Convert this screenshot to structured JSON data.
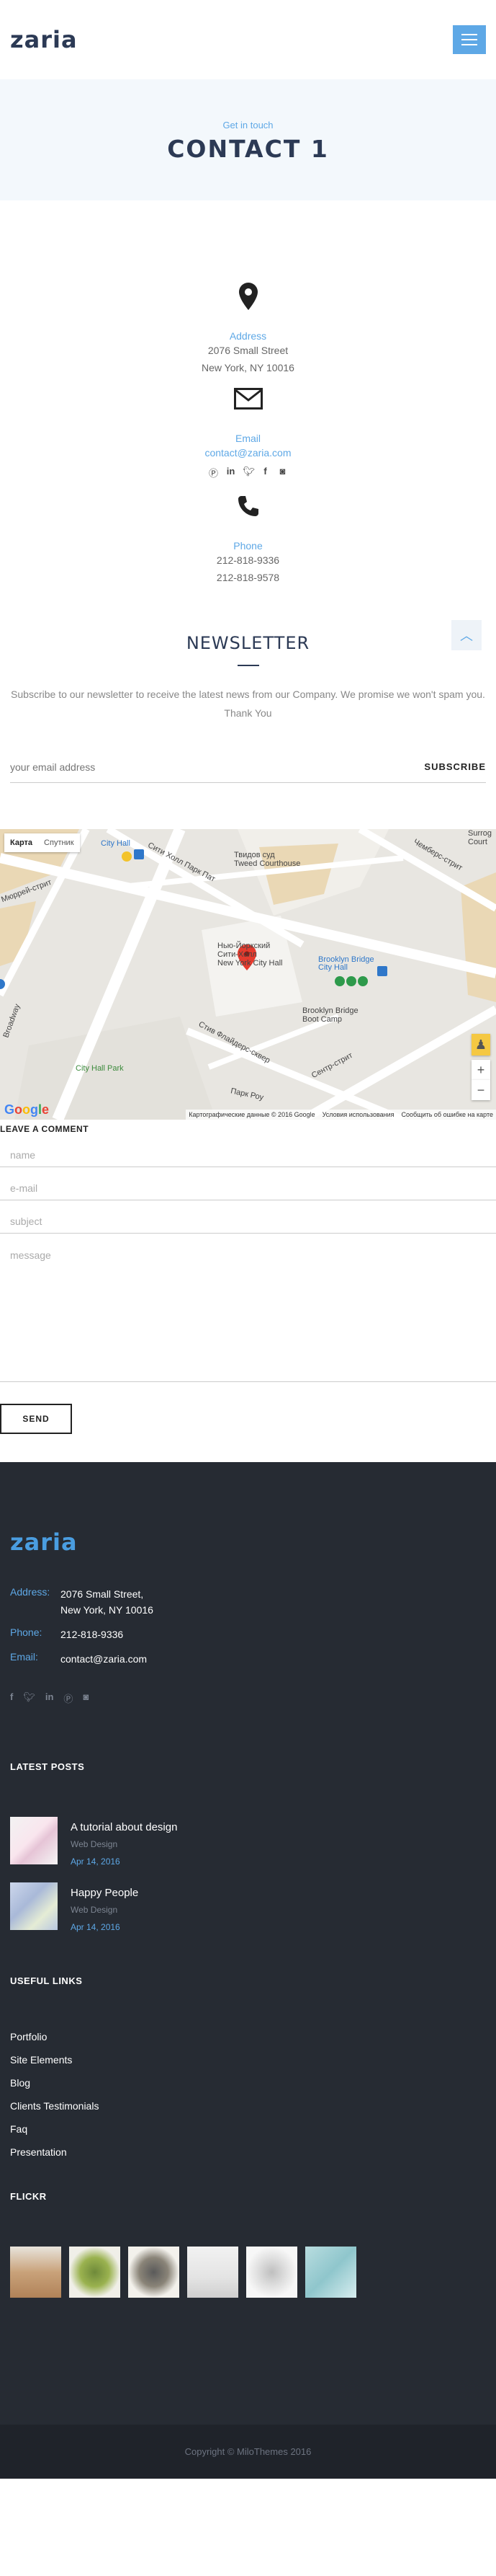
{
  "header": {
    "logo": "zaria",
    "menu_icon": "hamburger-icon"
  },
  "hero": {
    "subtitle": "Get in touch",
    "title": "CONTACT 1"
  },
  "contact": {
    "address": {
      "icon": "map-pin-icon",
      "label": "Address",
      "lines": [
        "2076 Small Street",
        "New York, NY 10016"
      ]
    },
    "email": {
      "icon": "envelope-icon",
      "label": "Email",
      "value": "contact@zaria.com"
    },
    "socials": [
      "pinterest-icon",
      "linkedin-icon",
      "twitter-icon",
      "facebook-icon",
      "instagram-icon"
    ],
    "phone": {
      "icon": "phone-icon",
      "label": "Phone",
      "lines": [
        "212-818-9336",
        "212-818-9578"
      ]
    }
  },
  "newsletter": {
    "title": "NEWSLETTER",
    "text": "Subscribe to our newsletter to receive the latest news from our Company. We promise we won't spam you. Thank You",
    "placeholder": "your email address",
    "button": "SUBSCRIBE"
  },
  "map": {
    "type_map": "Карта",
    "type_sat": "Спутник",
    "attribution": [
      "Картографические данные © 2016 Google",
      "Условия использования",
      "Сообщить об ошибке на карте"
    ],
    "google": "Google",
    "labels": {
      "courthouse": "Твидов суд\nTweed Courthouse",
      "city_hall_station": "City Hall",
      "city_hall": "Нью-Йоркский\nСити-Холл\nNew York City Hall",
      "brooklyn_bridge_station": "Brooklyn Bridge\nCity Hall",
      "boot_camp": "Brooklyn Bridge\nBoot Camp",
      "park": "City Hall Park",
      "park_row": "Парк Роу",
      "chambers": "Чемберс-стрит",
      "murray": "Мюррей-стрит",
      "broadway": "Broadway",
      "centre": "Сентр-стрит",
      "park_place": "Сити Холл Парк Пат",
      "frankfort": "Стив Флайдерс-сквер",
      "surrogate": "Surrog\nCourt",
      "subway_lines": "4 5 6"
    }
  },
  "comment": {
    "title": "LEAVE A COMMENT",
    "name": "name",
    "email": "e-mail",
    "subject": "subject",
    "message": "message",
    "send": "SEND"
  },
  "footer": {
    "logo": "zaria",
    "address_label": "Address:",
    "address_lines": [
      "2076 Small Street,",
      "New York, NY 10016"
    ],
    "phone_label": "Phone:",
    "phone": "212-818-9336",
    "email_label": "Email:",
    "email": "contact@zaria.com",
    "socials": [
      "facebook-icon",
      "twitter-icon",
      "linkedin-icon",
      "pinterest-icon",
      "instagram-icon"
    ],
    "latest_posts_title": "LATEST POSTS",
    "posts": [
      {
        "title": "A tutorial about design",
        "category": "Web Design",
        "date": "Apr 14, 2016"
      },
      {
        "title": "Happy People",
        "category": "Web Design",
        "date": "Apr 14, 2016"
      }
    ],
    "useful_links_title": "USEFUL LINKS",
    "links": [
      "Portfolio",
      "Site Elements",
      "Blog",
      "Clients Testimonials",
      "Faq",
      "Presentation"
    ],
    "flickr_title": "FLICKR",
    "copyright": "Copyright © MiloThemes 2016"
  },
  "colors": {
    "accent": "#5ea8e6",
    "dark": "#2c3a55",
    "footer_bg": "#262b33"
  }
}
